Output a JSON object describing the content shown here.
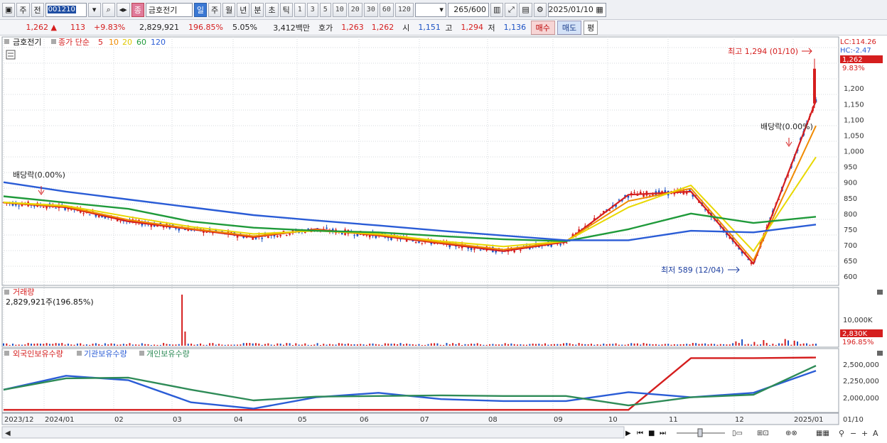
{
  "toolbar": {
    "type_label": "주",
    "prev_label": "전",
    "code": "001210",
    "name_badge": "종",
    "name": "금호전기",
    "periods": [
      "일",
      "주",
      "월",
      "년",
      "분",
      "초",
      "틱"
    ],
    "selected_period": "일",
    "intervals": [
      "1",
      "3",
      "5",
      "10",
      "20",
      "30",
      "60",
      "120"
    ],
    "count": "265",
    "count_total": "/600",
    "date": "2025/01/10"
  },
  "quote": {
    "price": "1,262",
    "arrow": "▲",
    "change": "113",
    "rate": "+9.83%",
    "volume": "2,829,921",
    "vol_ratio": "196.85%",
    "turnover": "5.05%",
    "amount": "3,412백만",
    "bidask_label": "호가",
    "ask": "1,263",
    "bid": "1,262",
    "open_label": "시",
    "open": "1,151",
    "high_label": "고",
    "high": "1,294",
    "low_label": "저",
    "low": "1,136",
    "buy_label": "매수",
    "sell_label": "매도",
    "even_label": "평"
  },
  "price_panel": {
    "title": "금호전기",
    "ma_label": "종가 단순",
    "ma_periods": [
      "5",
      "10",
      "20",
      "60",
      "120"
    ],
    "ma_colors": [
      "#d51e1e",
      "#f08a00",
      "#e8d800",
      "#1f9a3a",
      "#2a5cd6"
    ],
    "lc": "LC:114.26",
    "hc": "HC:-2.47",
    "current_tag": "1,262",
    "current_pct": "9.83%",
    "yticks": [
      "1,200",
      "1,150",
      "1,100",
      "1,050",
      "1,000",
      "950",
      "900",
      "850",
      "800",
      "750",
      "700",
      "650",
      "600"
    ],
    "high_note": "최고 1,294 (01/10)",
    "low_note": "최저 589 (12/04)",
    "dividend_note_left": "배당락(0.00%)",
    "dividend_note_right": "배당락(0.00%)"
  },
  "volume_panel": {
    "title": "거래량",
    "value": "2,829,921주(196.85%)",
    "ytick": "10,000K",
    "current_tag": "2,830K",
    "current_pct": "196.85%"
  },
  "holdings_panel": {
    "series": [
      "외국인보유수량",
      "기관보유수량",
      "개인보유수량"
    ],
    "colors": [
      "#d51e1e",
      "#2a5cd6",
      "#2e8b57"
    ],
    "yticks": [
      "2,500,000",
      "2,250,000",
      "2,000,000"
    ]
  },
  "xaxis": {
    "labels": [
      "2023/12",
      "2024/01",
      "02",
      "03",
      "04",
      "05",
      "06",
      "07",
      "08",
      "09",
      "10",
      "11",
      "12",
      "2025/01"
    ],
    "right_label": "01/10"
  },
  "chart_data": {
    "type": "line",
    "title": "금호전기",
    "x": [
      "2023/12",
      "2024/01",
      "02",
      "03",
      "04",
      "05",
      "06",
      "07",
      "08",
      "09",
      "10",
      "11",
      "12",
      "2025/01"
    ],
    "ylim": [
      580,
      1300
    ],
    "series": [
      {
        "name": "5",
        "values": [
          835,
          820,
          775,
          750,
          725,
          750,
          730,
          705,
          680,
          710,
          860,
          870,
          640,
          1160
        ]
      },
      {
        "name": "10",
        "values": [
          835,
          822,
          780,
          752,
          728,
          748,
          732,
          708,
          685,
          712,
          840,
          880,
          650,
          1080
        ]
      },
      {
        "name": "20",
        "values": [
          836,
          825,
          790,
          758,
          735,
          745,
          735,
          712,
          695,
          712,
          820,
          890,
          680,
          980
        ]
      },
      {
        "name": "60",
        "values": [
          855,
          835,
          815,
          775,
          755,
          745,
          740,
          728,
          718,
          712,
          750,
          800,
          770,
          790
        ]
      },
      {
        "name": "120",
        "values": [
          900,
          870,
          845,
          820,
          795,
          778,
          762,
          745,
          730,
          715,
          715,
          745,
          740,
          765
        ]
      }
    ],
    "high": 1294,
    "low": 589
  }
}
